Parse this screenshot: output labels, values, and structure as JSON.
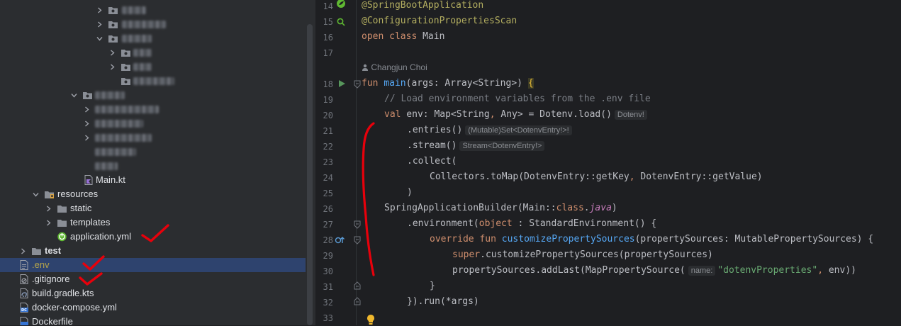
{
  "project_tree": {
    "items": [
      {
        "label": "Main.kt",
        "icon": "kotlin-file-icon"
      },
      {
        "label": "resources",
        "icon": "folder-icon"
      },
      {
        "label": "static",
        "icon": "folder-icon"
      },
      {
        "label": "templates",
        "icon": "folder-icon"
      },
      {
        "label": "application.yml",
        "icon": "spring-config-icon"
      },
      {
        "label": "test",
        "icon": "folder-icon"
      },
      {
        "label": ".env",
        "icon": "text-file-icon"
      },
      {
        "label": ".gitignore",
        "icon": "ignore-file-icon"
      },
      {
        "label": "build.gradle.kts",
        "icon": "gradle-file-icon"
      },
      {
        "label": "docker-compose.yml",
        "icon": "docker-compose-icon"
      },
      {
        "label": "Dockerfile",
        "icon": "docker-file-icon"
      }
    ]
  },
  "editor": {
    "line_numbers": [
      "14",
      "15",
      "16",
      "17",
      "18",
      "19",
      "20",
      "21",
      "22",
      "23",
      "24",
      "25",
      "26",
      "27",
      "28",
      "29",
      "30",
      "31",
      "32",
      "33"
    ],
    "author_hint": "Changjun Choi",
    "tok": {
      "l14": "@SpringBootApplication",
      "l15": "@ConfigurationPropertiesScan",
      "l16_open": "open",
      "l16_class": "class",
      "l16_name": "Main",
      "l18_fun": "fun",
      "l18_name": "main",
      "l18_params": "(args: Array<String>) ",
      "l18_brace": "{",
      "l19": "// Load environment variables from the .env file",
      "l20_val": "val",
      "l20_rest": " env: Map<String",
      "l20_comma": ",",
      "l20_rest2": " Any> = Dotenv.load()",
      "l20_hint": "Dotenv!",
      "l21": ".entries()",
      "l21_hint": "(Mutable)Set<DotenvEntry!>!",
      "l22": ".stream()",
      "l22_hint": "Stream<DotenvEntry!>",
      "l23": ".collect(",
      "l24_a": "Collectors.toMap(DotenvEntry::getKey",
      "l24_comma": ",",
      "l24_b": " DotenvEntry::getValue)",
      "l25": ")",
      "l26_a": "SpringApplicationBuilder(Main::",
      "l26_class": "class",
      "l26_dot": ".",
      "l26_java": "java",
      "l26_close": ")",
      "l27_a": ".environment(",
      "l27_object": "object",
      "l27_b": " : StandardEnvironment() {",
      "l28_override": "override",
      "l28_fun": "fun",
      "l28_name": "customizePropertySources",
      "l28_rest": "(propertySources: MutablePropertySources) {",
      "l29_super": "super",
      "l29_rest": ".customizePropertySources(propertySources)",
      "l30_a": "propertySources.addLast(MapPropertySource(",
      "l30_hint": "name:",
      "l30_str": "\"dotenvProperties\"",
      "l30_comma": ",",
      "l30_b": " env))",
      "l31": "}",
      "l32": "}).run(*args)"
    }
  },
  "colors": {
    "editor_bg": "#1e1f22",
    "tree_bg": "#2b2d30",
    "selection": "#2e436e",
    "annotation_mark": "#e8000b"
  }
}
